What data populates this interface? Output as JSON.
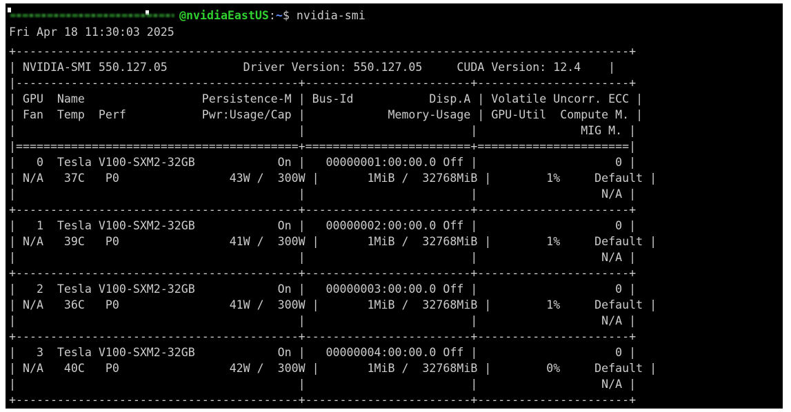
{
  "terminal": {
    "prompt": {
      "user_host": "@nvidiaEastUS",
      "separator": ":",
      "path": "~",
      "symbol": "$ ",
      "command": "nvidia-smi"
    },
    "timestamp": "Fri Apr 18 11:30:03 2025",
    "smi_header": {
      "smi_version": "NVIDIA-SMI 550.127.05",
      "driver_version": "Driver Version: 550.127.05",
      "cuda_version": "CUDA Version: 12.4"
    },
    "column_headers": {
      "row1": [
        "GPU",
        "Name",
        "Persistence-M",
        "Bus-Id",
        "Disp.A",
        "Volatile Uncorr. ECC"
      ],
      "row2": [
        "Fan",
        "Temp",
        "Perf",
        "Pwr:Usage/Cap",
        "Memory-Usage",
        "GPU-Util",
        "Compute M."
      ],
      "row3": [
        "MIG M."
      ]
    },
    "gpus": [
      {
        "index": "0",
        "name": "Tesla V100-SXM2-32GB",
        "persistence": "On",
        "bus_id": "00000001:00:00.0",
        "disp": "Off",
        "ecc": "0",
        "fan": "N/A",
        "temp": "37C",
        "perf": "P0",
        "power": "43W /  300W",
        "memory": "1MiB /  32768MiB",
        "util": "1%",
        "compute": "Default",
        "mig": "N/A"
      },
      {
        "index": "1",
        "name": "Tesla V100-SXM2-32GB",
        "persistence": "On",
        "bus_id": "00000002:00:00.0",
        "disp": "Off",
        "ecc": "0",
        "fan": "N/A",
        "temp": "39C",
        "perf": "P0",
        "power": "41W /  300W",
        "memory": "1MiB /  32768MiB",
        "util": "1%",
        "compute": "Default",
        "mig": "N/A"
      },
      {
        "index": "2",
        "name": "Tesla V100-SXM2-32GB",
        "persistence": "On",
        "bus_id": "00000003:00:00.0",
        "disp": "Off",
        "ecc": "0",
        "fan": "N/A",
        "temp": "36C",
        "perf": "P0",
        "power": "41W /  300W",
        "memory": "1MiB /  32768MiB",
        "util": "1%",
        "compute": "Default",
        "mig": "N/A"
      },
      {
        "index": "3",
        "name": "Tesla V100-SXM2-32GB",
        "persistence": "On",
        "bus_id": "00000004:00:00.0",
        "disp": "Off",
        "ecc": "0",
        "fan": "N/A",
        "temp": "40C",
        "perf": "P0",
        "power": "42W /  300W",
        "memory": "1MiB /  32768MiB",
        "util": "0%",
        "compute": "Default",
        "mig": "N/A"
      }
    ],
    "colors": {
      "background": "#000000",
      "foreground": "#cccccc",
      "prompt_user": "#2fd02f",
      "prompt_path": "#5f8fff"
    }
  }
}
